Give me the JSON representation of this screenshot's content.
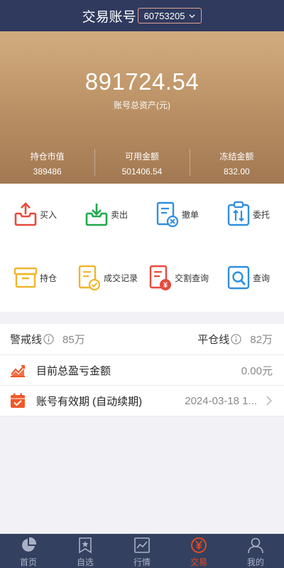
{
  "header": {
    "title": "交易账号",
    "account": "60753205"
  },
  "summary": {
    "total_assets": "891724.54",
    "total_label": "账号总资产(元)",
    "stats": [
      {
        "label": "持仓市值",
        "value": "389486"
      },
      {
        "label": "可用金额",
        "value": "501406.54"
      },
      {
        "label": "冻结金额",
        "value": "832.00"
      }
    ]
  },
  "actions": [
    {
      "label": "买入",
      "icon": "buy-icon"
    },
    {
      "label": "卖出",
      "icon": "sell-icon"
    },
    {
      "label": "撤单",
      "icon": "cancel-order-icon"
    },
    {
      "label": "委托",
      "icon": "entrust-icon"
    },
    {
      "label": "持仓",
      "icon": "position-icon"
    },
    {
      "label": "成交记录",
      "icon": "deal-record-icon"
    },
    {
      "label": "交割查询",
      "icon": "delivery-query-icon"
    },
    {
      "label": "查询",
      "icon": "query-icon"
    }
  ],
  "risk": {
    "warning_label": "警戒线",
    "warning_value": "85万",
    "close_label": "平仓线",
    "close_value": "82万"
  },
  "pnl": {
    "label": "目前总盈亏金额",
    "value": "0.00元"
  },
  "validity": {
    "label": "账号有效期 (自动续期)",
    "value": "2024-03-18 1..."
  },
  "tabs": [
    {
      "label": "首页",
      "icon": "home-pie-icon",
      "active": false
    },
    {
      "label": "自选",
      "icon": "bookmark-star-icon",
      "active": false
    },
    {
      "label": "行情",
      "icon": "market-chart-icon",
      "active": false
    },
    {
      "label": "交易",
      "icon": "yen-circle-icon",
      "active": true
    },
    {
      "label": "我的",
      "icon": "user-icon",
      "active": false
    }
  ],
  "colors": {
    "header_bg": "#2f3a5e",
    "hero_top": "#d2ac7f",
    "hero_bottom": "#a27852",
    "accent": "#f04a1a",
    "tabbar_bg": "#34405f"
  }
}
